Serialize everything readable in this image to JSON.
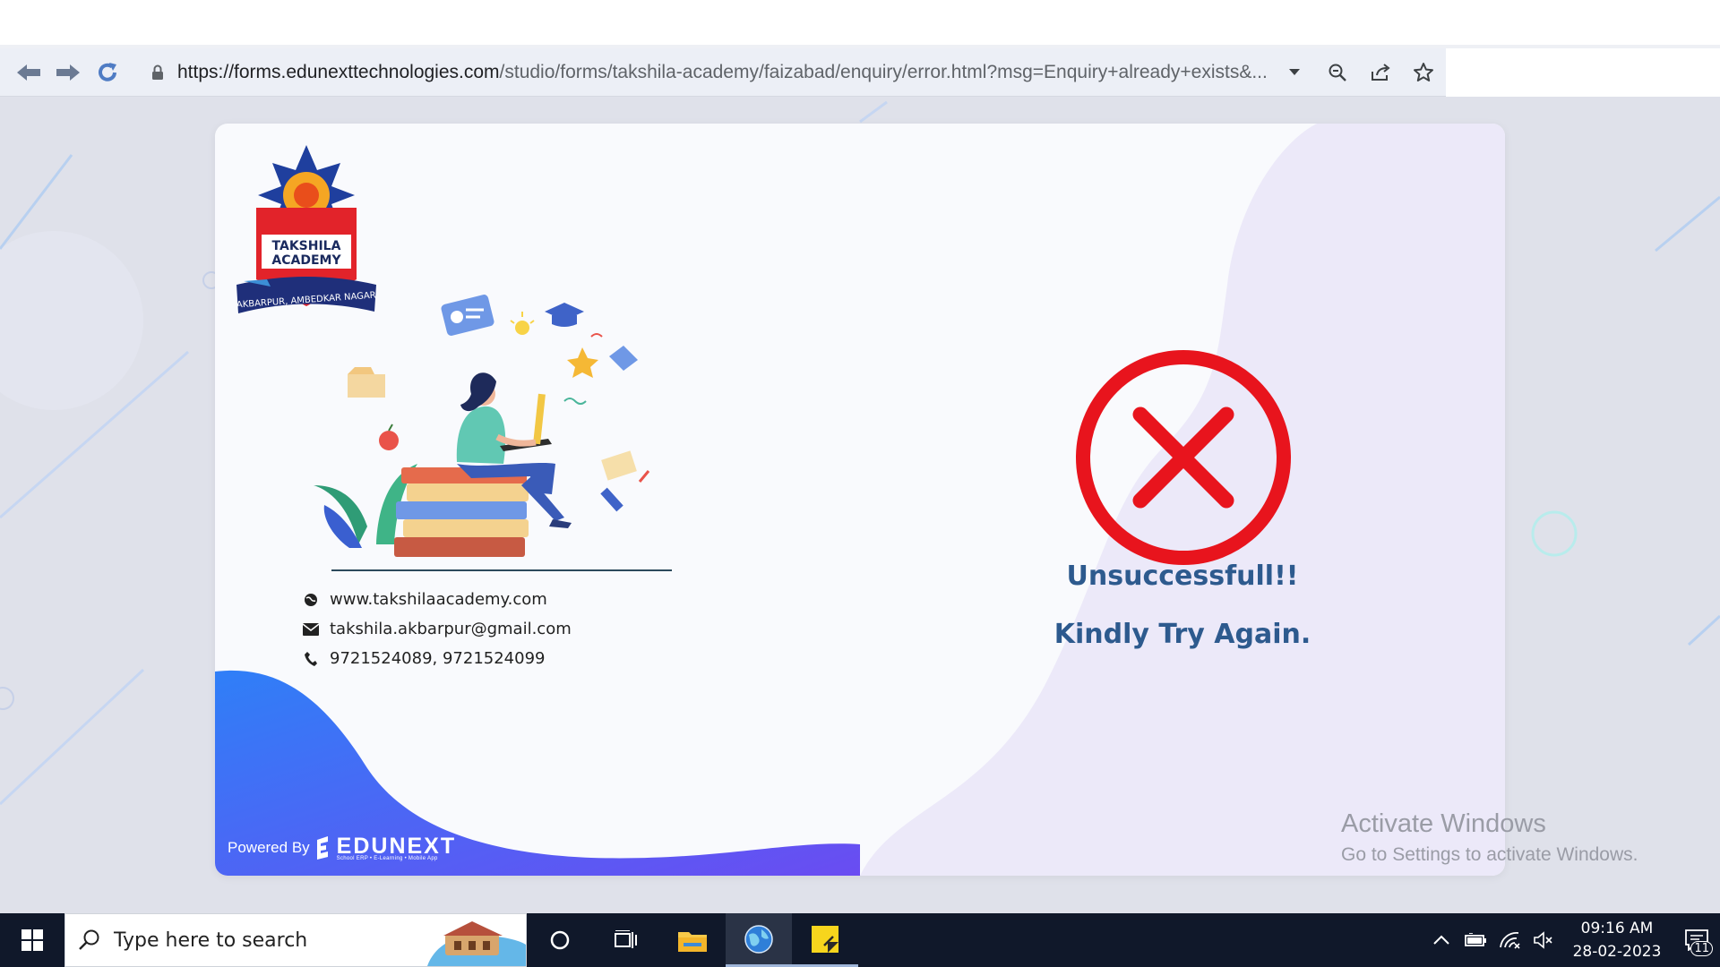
{
  "browser": {
    "url_host": "https://forms.edunexttechnologies.com",
    "url_path": "/studio/forms/takshila-academy/faizabad/enquiry/error.html?msg=Enquiry+already+exists&..."
  },
  "logo": {
    "line1": "TAKSHILA",
    "line2": "ACADEMY",
    "banner": "AKBARPUR, AMBEDKAR NAGAR"
  },
  "contacts": {
    "website": "www.takshilaacademy.com",
    "email": "takshila.akbarpur@gmail.com",
    "phone": "9721524089, 9721524099"
  },
  "footer": {
    "powered_by": "Powered By",
    "brand": "EDUNEXT",
    "brand_sub": "School ERP • E-Learning • Mobile App"
  },
  "result": {
    "title": "Unsuccessfull!!",
    "subtitle": "Kindly Try Again."
  },
  "watermark": {
    "line1": "Activate Windows",
    "line2": "Go to Settings to activate Windows."
  },
  "taskbar": {
    "search_placeholder": "Type here to search",
    "time": "09:16 AM",
    "date": "28-02-2023",
    "notification_count": "11"
  },
  "colors": {
    "error_red": "#e8141d",
    "message_blue": "#2d5a8e",
    "wave_blue": "#3b6cf5",
    "taskbar": "#10182a"
  }
}
